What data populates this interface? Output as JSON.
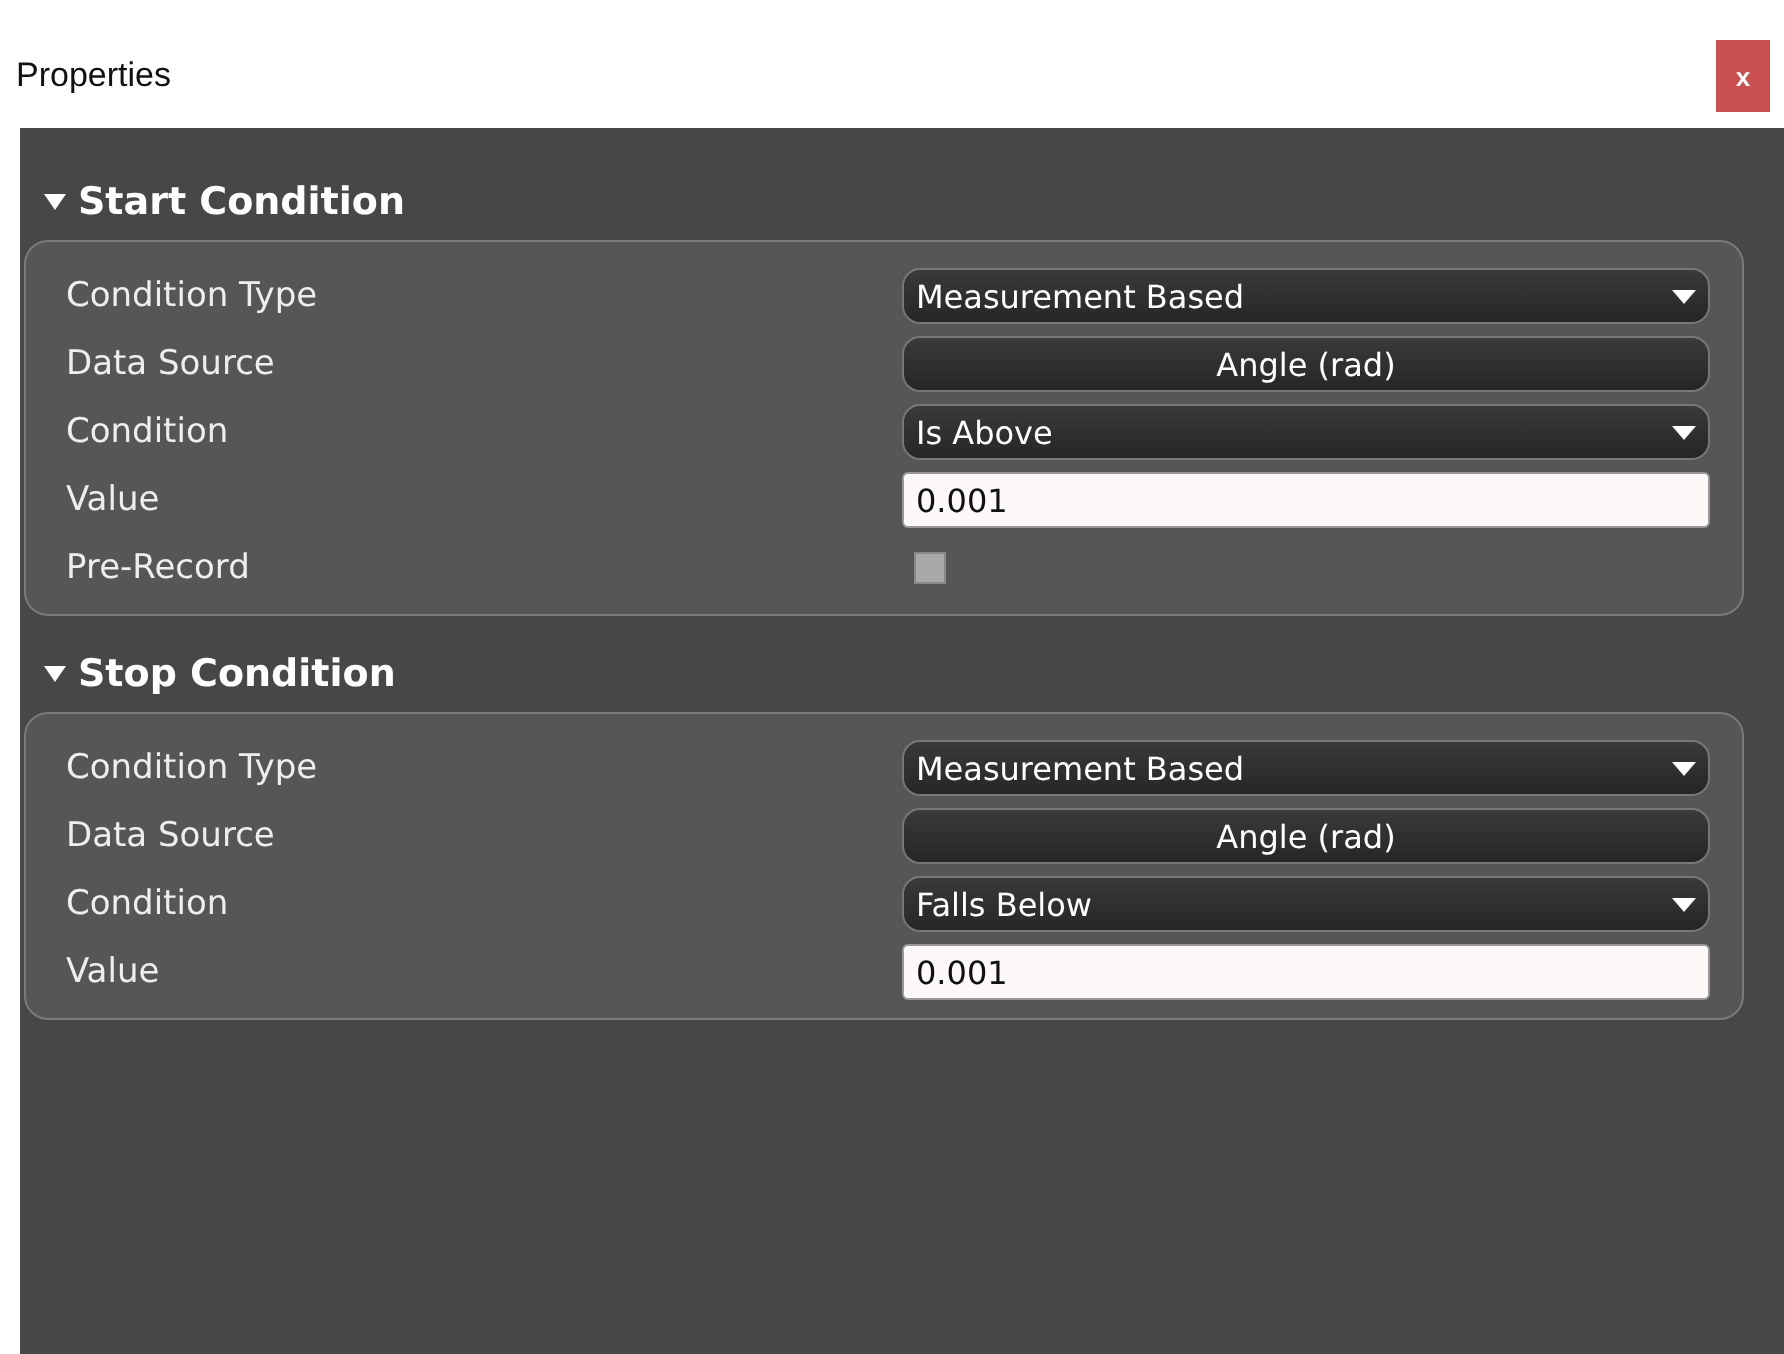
{
  "window": {
    "title": "Properties",
    "close_label": "x"
  },
  "sections": [
    {
      "title": "Start Condition",
      "expanded": true,
      "rows": [
        {
          "label": "Condition Type",
          "kind": "dropdown",
          "value": "Measurement Based"
        },
        {
          "label": "Data Source",
          "kind": "button",
          "value": "Angle (rad)"
        },
        {
          "label": "Condition",
          "kind": "dropdown",
          "value": "Is Above"
        },
        {
          "label": "Value",
          "kind": "input",
          "value": "0.001"
        },
        {
          "label": "Pre-Record",
          "kind": "checkbox",
          "checked": false
        }
      ]
    },
    {
      "title": "Stop Condition",
      "expanded": true,
      "rows": [
        {
          "label": "Condition Type",
          "kind": "dropdown",
          "value": "Measurement Based"
        },
        {
          "label": "Data Source",
          "kind": "button",
          "value": "Angle (rad)"
        },
        {
          "label": "Condition",
          "kind": "dropdown",
          "value": "Falls Below"
        },
        {
          "label": "Value",
          "kind": "input",
          "value": "0.001"
        }
      ]
    }
  ]
}
